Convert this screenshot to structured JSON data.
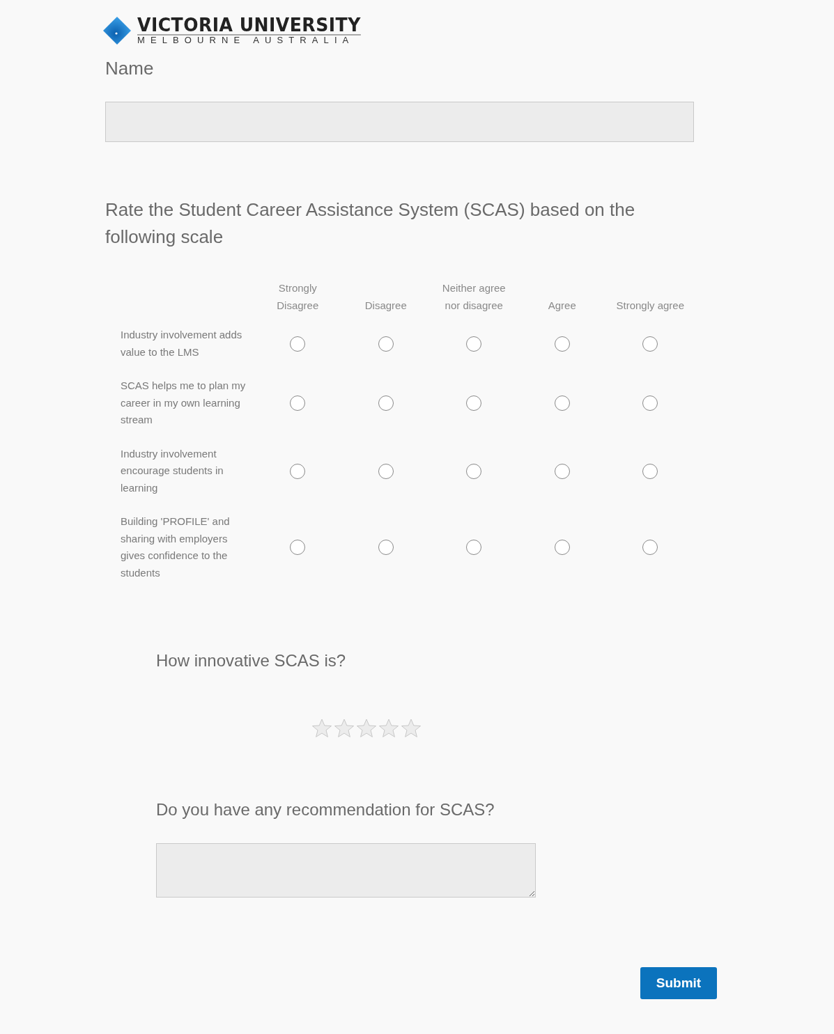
{
  "logo": {
    "title": "VICTORIA UNIVERSITY",
    "subtitle": "MELBOURNE AUSTRALIA"
  },
  "name_field": {
    "label": "Name"
  },
  "matrix": {
    "question": "Rate the Student Career Assistance System (SCAS) based on the following scale",
    "columns": [
      "Strongly Disagree",
      "Disagree",
      "Neither agree nor disagree",
      "Agree",
      "Strongly agree"
    ],
    "rows": [
      {
        "statement": "Industry involvement adds value to the LMS",
        "options": [
          {
            "selected": false
          },
          {
            "selected": false
          },
          {
            "selected": false
          },
          {
            "selected": false
          },
          {
            "selected": false
          }
        ]
      },
      {
        "statement": "SCAS helps me to plan my career in my own learning stream",
        "options": [
          {
            "selected": false
          },
          {
            "selected": false
          },
          {
            "selected": false
          },
          {
            "selected": false
          },
          {
            "selected": false
          }
        ]
      },
      {
        "statement": "Industry involvement encourage students in learning",
        "options": [
          {
            "selected": false
          },
          {
            "selected": false
          },
          {
            "selected": false
          },
          {
            "selected": false
          },
          {
            "selected": false
          }
        ]
      },
      {
        "statement": "Building 'PROFILE' and sharing with employers gives confidence to the students",
        "options": [
          {
            "selected": false
          },
          {
            "selected": false
          },
          {
            "selected": false
          },
          {
            "selected": false
          },
          {
            "selected": false
          }
        ]
      }
    ]
  },
  "rating": {
    "question": "How innovative SCAS is?",
    "stars": 0
  },
  "recommendation": {
    "question": "Do you have any recommendation for SCAS?"
  },
  "submit": "Submit"
}
